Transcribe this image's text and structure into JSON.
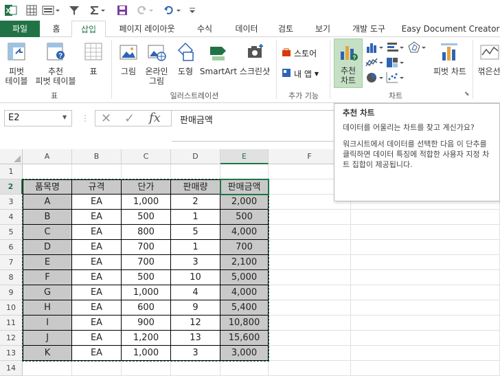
{
  "qat": {
    "app_icon": "excel-icon"
  },
  "tabs": [
    "파일",
    "홈",
    "삽입",
    "페이지 레이아웃",
    "수식",
    "데이터",
    "검토",
    "보기",
    "개발 도구",
    "Easy Document Creator"
  ],
  "ribbon": {
    "pivot": "피벗\n테이블",
    "recommended_pivot": "추천\n피벗 테이블",
    "table": "표",
    "group_table": "표",
    "picture": "그림",
    "online_picture": "온라인\n그림",
    "shapes": "도형",
    "smartart": "SmartArt",
    "screenshot": "스크린샷",
    "group_illustration": "일러스트레이션",
    "store": "스토어",
    "myapps": "내 앱",
    "group_addins": "추가 기능",
    "recommended_charts": "추천\n차트",
    "pivot_chart": "피벗 차트",
    "line_sparkline": "꺾은선",
    "group_charts": "차트"
  },
  "namebox": "E2",
  "formula": "판매금액",
  "columns": [
    "A",
    "B",
    "C",
    "D",
    "E",
    "F"
  ],
  "rows": [
    "1",
    "2",
    "3",
    "4",
    "5",
    "6",
    "7",
    "8",
    "9",
    "10",
    "11",
    "12",
    "13",
    "14"
  ],
  "table": {
    "headers": [
      "품목명",
      "규격",
      "단가",
      "판매량",
      "판매금액"
    ],
    "rows": [
      [
        "A",
        "EA",
        "1,000",
        "2",
        "2,000"
      ],
      [
        "B",
        "EA",
        "500",
        "1",
        "500"
      ],
      [
        "C",
        "EA",
        "800",
        "5",
        "4,000"
      ],
      [
        "D",
        "EA",
        "700",
        "1",
        "700"
      ],
      [
        "E",
        "EA",
        "700",
        "3",
        "2,100"
      ],
      [
        "F",
        "EA",
        "500",
        "10",
        "5,000"
      ],
      [
        "G",
        "EA",
        "1,000",
        "4",
        "4,000"
      ],
      [
        "H",
        "EA",
        "600",
        "9",
        "5,400"
      ],
      [
        "I",
        "EA",
        "900",
        "12",
        "10,800"
      ],
      [
        "J",
        "EA",
        "1,200",
        "13",
        "15,600"
      ],
      [
        "K",
        "EA",
        "1,000",
        "3",
        "3,000"
      ]
    ]
  },
  "tooltip": {
    "title": "추천 차트",
    "p1": "데이터를 어울리는 차트를 찾고 계신가요?",
    "p2": "워크시트에서 데이터를 선택한 다음 이 단추를 클릭하면 데이터 특징에 적합한 사용자 지정 차트 집합이 제공됩니다."
  },
  "colors": {
    "accent": "#217346",
    "selected_cell_fill": "#c9c9c9"
  }
}
